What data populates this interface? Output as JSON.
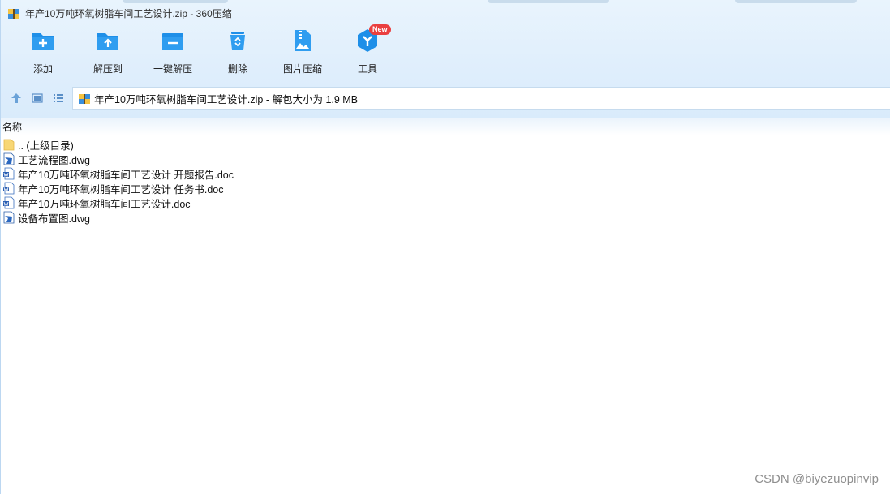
{
  "window": {
    "title": "年产10万吨环氧树脂车间工艺设计.zip - 360压缩"
  },
  "toolbar": {
    "items": [
      {
        "label": "添加",
        "icon": "add-folder-icon"
      },
      {
        "label": "解压到",
        "icon": "extract-to-icon"
      },
      {
        "label": "一键解压",
        "icon": "one-click-extract-icon"
      },
      {
        "label": "删除",
        "icon": "recycle-bin-icon"
      },
      {
        "label": "图片压缩",
        "icon": "image-compress-icon"
      },
      {
        "label": "工具",
        "icon": "tools-icon",
        "badge": "New"
      }
    ]
  },
  "addressbar": {
    "text": "年产10万吨环氧树脂车间工艺设计.zip - 解包大小为 1.9 MB"
  },
  "list": {
    "column_name": "名称",
    "files": [
      {
        "name": ".. (上级目录)",
        "type": "folder"
      },
      {
        "name": "工艺流程图.dwg",
        "type": "dwg"
      },
      {
        "name": "年产10万吨环氧树脂车间工艺设计 开题报告.doc",
        "type": "doc"
      },
      {
        "name": "年产10万吨环氧树脂车间工艺设计 任务书.doc",
        "type": "doc"
      },
      {
        "name": "年产10万吨环氧树脂车间工艺设计.doc",
        "type": "doc"
      },
      {
        "name": "设备布置图.dwg",
        "type": "dwg"
      }
    ]
  },
  "watermark": "CSDN @biyezuopinvip",
  "colors": {
    "accent": "#1e8fe8",
    "badge": "#ea3f3f",
    "toolbar_bg": "#dfeefc"
  }
}
